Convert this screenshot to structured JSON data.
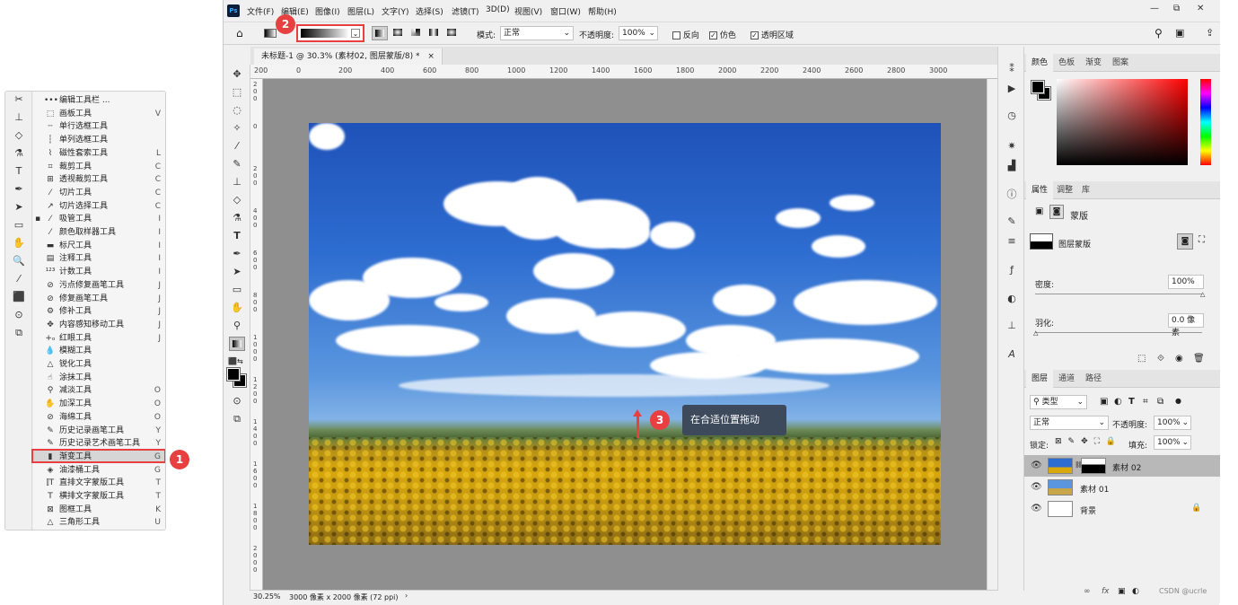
{
  "flyout": {
    "strip_icons": [
      "✂",
      "⊥",
      "◇",
      "⚗",
      "T",
      "✒",
      "➤",
      "▭",
      "✋",
      "🔍",
      "⁄",
      "⬛",
      "⊙",
      "⧉"
    ],
    "items": [
      {
        "icon": "•••",
        "label": "编辑工具栏 ...",
        "key": ""
      },
      {
        "icon": "⬚",
        "label": "画板工具",
        "key": "V"
      },
      {
        "icon": "┄",
        "label": "单行选框工具",
        "key": ""
      },
      {
        "icon": "┆",
        "label": "单列选框工具",
        "key": ""
      },
      {
        "icon": "⌇",
        "label": "磁性套索工具",
        "key": "L"
      },
      {
        "icon": "⌗",
        "label": "裁剪工具",
        "key": "C"
      },
      {
        "icon": "⊞",
        "label": "透视裁剪工具",
        "key": "C"
      },
      {
        "icon": "⁄",
        "label": "切片工具",
        "key": "C"
      },
      {
        "icon": "↗",
        "label": "切片选择工具",
        "key": "C"
      },
      {
        "icon": "⁄",
        "label": "吸管工具",
        "key": "I",
        "dot": true
      },
      {
        "icon": "⁄",
        "label": "颜色取样器工具",
        "key": "I"
      },
      {
        "icon": "▬",
        "label": "标尺工具",
        "key": "I"
      },
      {
        "icon": "▤",
        "label": "注释工具",
        "key": "I"
      },
      {
        "icon": "¹²³",
        "label": "计数工具",
        "key": "I"
      },
      {
        "icon": "⊘",
        "label": "污点修复画笔工具",
        "key": "J"
      },
      {
        "icon": "⊘",
        "label": "修复画笔工具",
        "key": "J"
      },
      {
        "icon": "⚙",
        "label": "修补工具",
        "key": "J"
      },
      {
        "icon": "✥",
        "label": "内容感知移动工具",
        "key": "J"
      },
      {
        "icon": "+ₒ",
        "label": "红眼工具",
        "key": "J"
      },
      {
        "icon": "💧",
        "label": "模糊工具",
        "key": ""
      },
      {
        "icon": "△",
        "label": "锐化工具",
        "key": ""
      },
      {
        "icon": "☝",
        "label": "涂抹工具",
        "key": ""
      },
      {
        "icon": "⚲",
        "label": "减淡工具",
        "key": "O"
      },
      {
        "icon": "✋",
        "label": "加深工具",
        "key": "O"
      },
      {
        "icon": "⊘",
        "label": "海绵工具",
        "key": "O"
      },
      {
        "icon": "✎",
        "label": "历史记录画笔工具",
        "key": "Y"
      },
      {
        "icon": "✎",
        "label": "历史记录艺术画笔工具",
        "key": "Y"
      },
      {
        "icon": "▮",
        "label": "渐变工具",
        "key": "G",
        "highlight": true
      },
      {
        "icon": "◈",
        "label": "油漆桶工具",
        "key": "G"
      },
      {
        "icon": "⫿T",
        "label": "直排文字蒙版工具",
        "key": "T"
      },
      {
        "icon": "T",
        "label": "横排文字蒙版工具",
        "key": "T"
      },
      {
        "icon": "⊠",
        "label": "图框工具",
        "key": "K"
      },
      {
        "icon": "△",
        "label": "三角形工具",
        "key": "U"
      }
    ]
  },
  "badges": {
    "b1": "1",
    "b2": "2",
    "b3": "3"
  },
  "menubar": {
    "logo": "Ps",
    "items": [
      "文件(F)",
      "编辑(E)",
      "图像(I)",
      "图层(L)",
      "文字(Y)",
      "选择(S)",
      "滤镜(T)",
      "3D(D)",
      "视图(V)",
      "窗口(W)",
      "帮助(H)"
    ],
    "win_controls": [
      "—",
      "⧉",
      "✕",
      "—",
      "⧉",
      "✕"
    ]
  },
  "options": {
    "mode_label": "模式:",
    "mode_value": "正常",
    "opacity_label": "不透明度:",
    "opacity_value": "100%",
    "reverse_label": "反向",
    "dither_label": "仿色",
    "transparency_label": "透明区域"
  },
  "document": {
    "tab_title": "未标题-1 @ 30.3% (素材02, 图层蒙版/8) *",
    "tab_close": "×",
    "zoom": "30.25%",
    "dimensions": "3000 像素 x 2000 像素 (72 ppi)",
    "status_arrow": "›"
  },
  "ruler": {
    "top": [
      "200",
      "0",
      "200",
      "400",
      "600",
      "800",
      "1000",
      "1200",
      "1400",
      "1600",
      "1800",
      "2000",
      "2200",
      "2400",
      "2600",
      "2800",
      "3000"
    ],
    "left": [
      "2 0 0",
      "0",
      "2 0 0",
      "4 0 0",
      "6 0 0",
      "8 0 0",
      "1 0 0 0",
      "1 2 0 0",
      "1 4 0 0",
      "1 6 0 0",
      "1 8 0 0",
      "2 0 0 0"
    ]
  },
  "tooltip": {
    "text": "在合适位置拖动"
  },
  "color_panel": {
    "tabs": [
      "颜色",
      "色板",
      "渐变",
      "图案"
    ]
  },
  "properties_panel": {
    "tabs": [
      "属性",
      "调整",
      "库"
    ],
    "title": "蒙版",
    "layer_mask_label": "图层蒙版",
    "density_label": "密度:",
    "density_value": "100%",
    "feather_label": "羽化:",
    "feather_value": "0.0 像素"
  },
  "layers_panel": {
    "tabs": [
      "图层",
      "通道",
      "路径"
    ],
    "kind_label": "类型",
    "blend_mode": "正常",
    "opacity_label": "不透明度:",
    "opacity_value": "100%",
    "lock_label": "锁定:",
    "fill_label": "填充:",
    "fill_value": "100%",
    "layers": [
      {
        "name": "素材 02"
      },
      {
        "name": "素材 01"
      },
      {
        "name": "背景"
      }
    ],
    "footer_icons": [
      "∞",
      "fx"
    ]
  },
  "watermark": "CSDN @ucrle"
}
